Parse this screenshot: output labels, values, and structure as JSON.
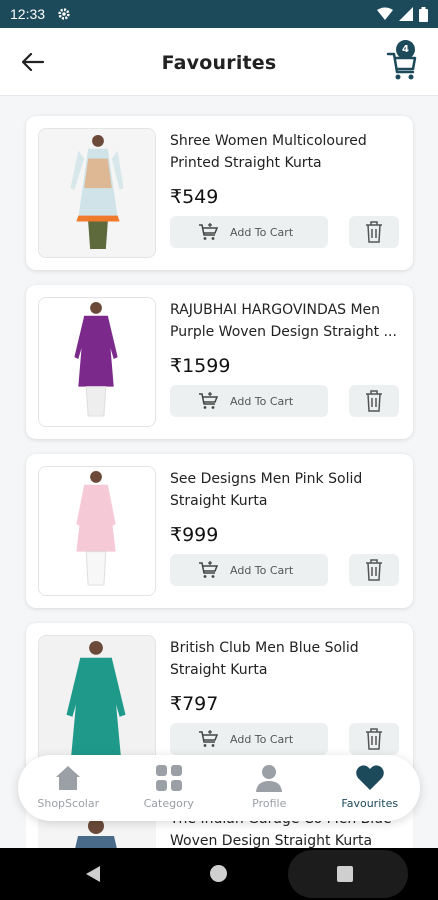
{
  "status_bar": {
    "time": "12:33"
  },
  "header": {
    "title": "Favourites",
    "cart_count": "4"
  },
  "products": [
    {
      "name": "Shree Women Multicoloured Printed Straight Kurta",
      "price": "₹549",
      "add_label": "Add To Cart"
    },
    {
      "name": "RAJUBHAI HARGOVINDAS Men Purple Woven Design Straight ...",
      "price": "₹1599",
      "add_label": "Add To Cart"
    },
    {
      "name": "See Designs Men Pink Solid Straight Kurta",
      "price": "₹999",
      "add_label": "Add To Cart"
    },
    {
      "name": "British Club Men Blue Solid Straight Kurta",
      "price": "₹797",
      "add_label": "Add To Cart"
    },
    {
      "name": "The Indian Garage Co Men Blue Woven Design Straight Kurta"
    }
  ],
  "bottom_nav": [
    {
      "label": "ShopScolar",
      "icon": "home-icon"
    },
    {
      "label": "Category",
      "icon": "grid-icon"
    },
    {
      "label": "Profile",
      "icon": "person-icon"
    },
    {
      "label": "Favourites",
      "icon": "heart-icon",
      "active": true
    }
  ],
  "colors": {
    "primary": "#1d4a5b",
    "muted": "#9aa0a6",
    "button_bg": "#edf0f1",
    "background": "#f4f6f8"
  }
}
